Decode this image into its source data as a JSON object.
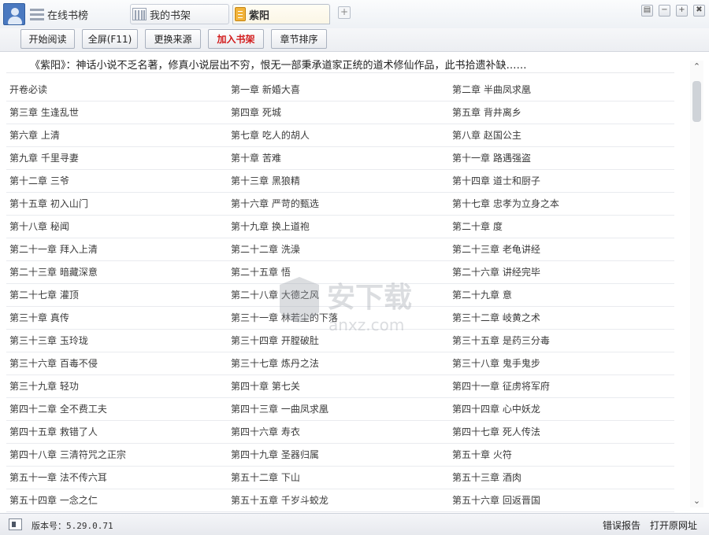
{
  "tabs": {
    "rank_label": "在线书榜",
    "shelf_label": "我的书架",
    "book_label": "紫阳",
    "add_tab": "+"
  },
  "window_buttons": {
    "skin": "▤",
    "minimize": "−",
    "maximize": "+",
    "close": "✖"
  },
  "toolbar": {
    "start_reading": "开始阅读",
    "fullscreen": "全屏(F11)",
    "change_source": "更换来源",
    "add_to_shelf": "加入书架",
    "sort_chapters": "章节排序"
  },
  "book": {
    "intro": "《紫阳》：神话小说不乏名著，修真小说层出不穷，恨无一部秉承道家正统的道术修仙作品，此书拾遗补缺……"
  },
  "chapters": [
    [
      "开卷必读",
      "第一章 新婚大喜",
      "第二章 半曲凤求凰"
    ],
    [
      "第三章 生逢乱世",
      "第四章 死城",
      "第五章 背井离乡"
    ],
    [
      "第六章 上清",
      "第七章 吃人的胡人",
      "第八章 赵国公主"
    ],
    [
      "第九章 千里寻妻",
      "第十章 苦难",
      "第十一章 路遇强盗"
    ],
    [
      "第十二章 三爷",
      "第十三章 黑狼精",
      "第十四章 道士和厨子"
    ],
    [
      "第十五章 初入山门",
      "第十六章 严苛的甄选",
      "第十七章 忠孝为立身之本"
    ],
    [
      "第十八章 秘闻",
      "第十九章 换上道袍",
      "第二十章 度"
    ],
    [
      "第二十一章 拜入上清",
      "第二十二章 洗澡",
      "第二十三章 老龟讲经"
    ],
    [
      "第二十三章 暗藏深意",
      "第二十五章 悟",
      "第二十六章 讲经完毕"
    ],
    [
      "第二十七章 灌顶",
      "第二十八章 大德之风",
      "第二十九章 意"
    ],
    [
      "第三十章 真传",
      "第三十一章 林若尘的下落",
      "第三十二章 岐黄之术"
    ],
    [
      "第三十三章 玉玲珑",
      "第三十四章 开膛破肚",
      "第三十五章 是药三分毒"
    ],
    [
      "第三十六章 百毒不侵",
      "第三十七章 炼丹之法",
      "第三十八章 鬼手鬼步"
    ],
    [
      "第三十九章 轻功",
      "第四十章 第七关",
      "第四十一章 征虏将军府"
    ],
    [
      "第四十二章 全不费工夫",
      "第四十三章 一曲凤求凰",
      "第四十四章 心中妖龙"
    ],
    [
      "第四十五章 救错了人",
      "第四十六章 寿衣",
      "第四十七章 死人传法"
    ],
    [
      "第四十八章 三清符咒之正宗",
      "第四十九章 圣器归属",
      "第五十章 火符"
    ],
    [
      "第五十一章 法不传六耳",
      "第五十二章 下山",
      "第五十三章 酒肉"
    ],
    [
      "第五十四章 一念之仁",
      "第五十五章 千岁斗蛟龙",
      "第五十六章 回返晋国"
    ]
  ],
  "watermark": {
    "title": "安下载",
    "subtitle": "anxz.com"
  },
  "scrollbar": {
    "up": "⌃",
    "down": "⌄"
  },
  "status": {
    "version": "版本号：5.29.0.71",
    "error_report": "错误报告",
    "open_source": "打开原网址"
  },
  "colors": {
    "accent_red": "#d21a1a",
    "book_icon": "#f2b33a",
    "avatar": "#4a79c0"
  }
}
